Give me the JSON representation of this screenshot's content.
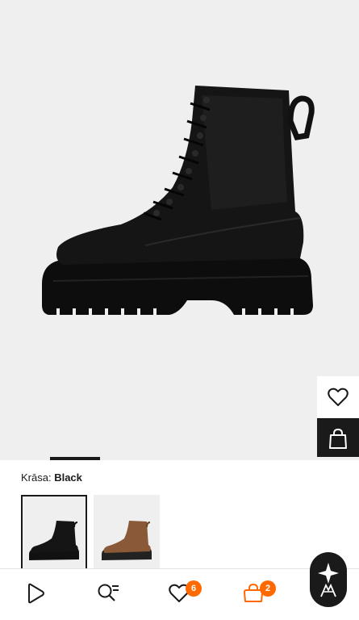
{
  "product": {
    "image_alt_name": "black-lace-up-platform-boot",
    "gallery_progress": 0.14
  },
  "actions": {
    "wishlist_icon": "heart-outline-icon",
    "add_to_bag_icon": "shopping-bag-icon"
  },
  "color": {
    "label": "Krāsa:",
    "selected": "Black",
    "options": [
      {
        "name": "black",
        "swatch": "#111111",
        "selected": true
      },
      {
        "name": "brown",
        "swatch": "#8a5a38",
        "selected": false
      }
    ]
  },
  "nav": {
    "items": [
      {
        "icon": "play-logo-icon"
      },
      {
        "icon": "search-list-icon"
      },
      {
        "icon": "heart-icon",
        "badge": "6"
      },
      {
        "icon": "bag-icon",
        "badge": "2"
      }
    ],
    "badge_color": "#ff6900"
  },
  "assistant": {
    "icon": "assistant-sparkle-icon"
  }
}
